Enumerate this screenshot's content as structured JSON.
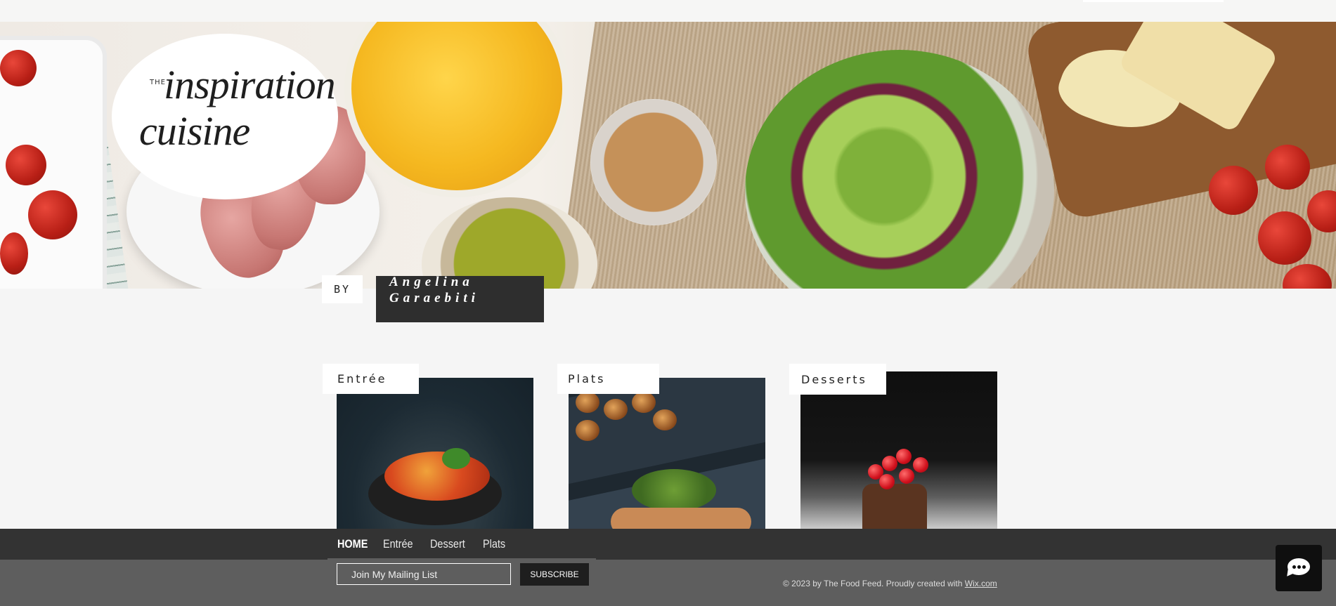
{
  "brand": {
    "the": "THE",
    "line1": "inspiration",
    "line2": "cuisine"
  },
  "author": {
    "by_label": "BY",
    "name": "Angelina Garaebiti"
  },
  "categories": [
    {
      "label": "Entrée"
    },
    {
      "label": "Plats"
    },
    {
      "label": "Desserts"
    }
  ],
  "nav": {
    "items": [
      "HOME",
      "Entrée",
      "Dessert",
      "Plats"
    ],
    "active": "HOME"
  },
  "footer": {
    "mailing_placeholder": "Join My Mailing List",
    "subscribe_label": "SUBSCRIBE",
    "copyright_text": "© 2023 by The Food Feed. Proudly created with ",
    "copyright_link": "Wix.com"
  },
  "chat": {
    "icon": "chat-bubble-icon"
  },
  "colors": {
    "nav_bg": "#333333",
    "footer_bg": "#5e5e5e",
    "author_bg": "#2e2e2e",
    "page_bg": "#f5f5f5"
  }
}
